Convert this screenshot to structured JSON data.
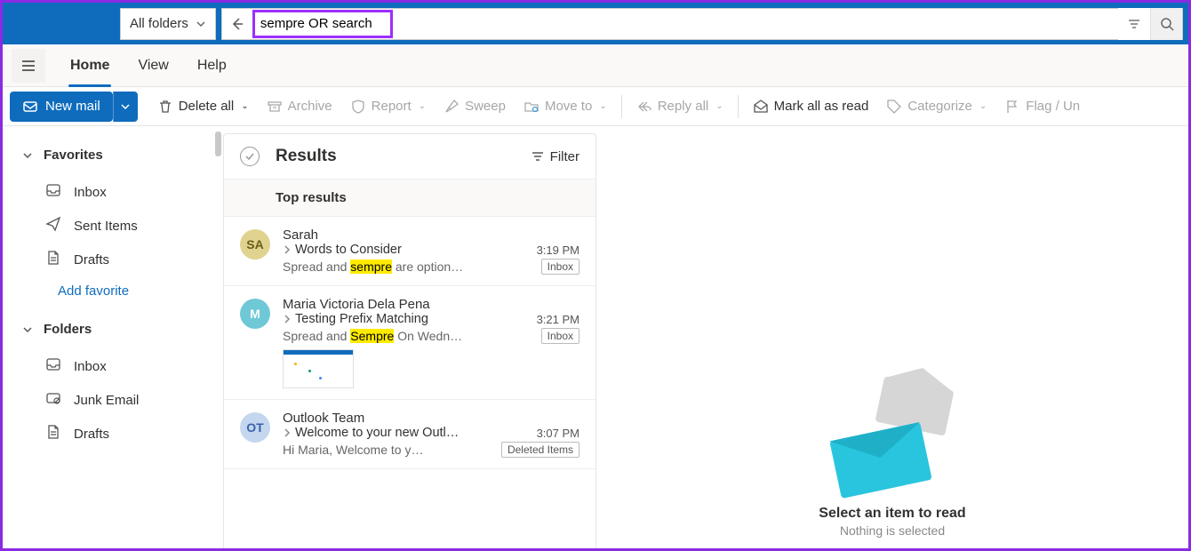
{
  "search": {
    "folder_scope": "All folders",
    "query": "sempre OR search"
  },
  "tabs": [
    "Home",
    "View",
    "Help"
  ],
  "active_tab": 0,
  "toolbar": {
    "new_mail": "New mail",
    "delete_all": "Delete all",
    "archive": "Archive",
    "report": "Report",
    "sweep": "Sweep",
    "move_to": "Move to",
    "reply_all": "Reply all",
    "mark_read": "Mark all as read",
    "categorize": "Categorize",
    "flag": "Flag / Un"
  },
  "sidebar": {
    "sections": [
      {
        "label": "Favorites",
        "items": [
          {
            "icon": "inbox",
            "label": "Inbox"
          },
          {
            "icon": "sent",
            "label": "Sent Items"
          },
          {
            "icon": "draft",
            "label": "Drafts"
          },
          {
            "icon": "link",
            "label": "Add favorite"
          }
        ]
      },
      {
        "label": "Folders",
        "items": [
          {
            "icon": "inbox",
            "label": "Inbox"
          },
          {
            "icon": "junk",
            "label": "Junk Email"
          },
          {
            "icon": "draft",
            "label": "Drafts"
          }
        ]
      }
    ]
  },
  "results": {
    "title": "Results",
    "filter": "Filter",
    "sub": "Top results",
    "items": [
      {
        "initials": "SA",
        "avatar_bg": "#e0d38f",
        "avatar_fg": "#6b5d1a",
        "from": "Sarah",
        "subject": "Words to Consider",
        "time": "3:19 PM",
        "preview_pre": "Spread and ",
        "preview_hl": "sempre",
        "preview_post": " are option…",
        "tag": "Inbox",
        "thumb": false
      },
      {
        "initials": "M",
        "avatar_bg": "#6fc8d6",
        "avatar_fg": "#fff",
        "from": "Maria Victoria Dela Pena",
        "subject": "Testing Prefix Matching",
        "time": "3:21 PM",
        "preview_pre": "Spread and ",
        "preview_hl": "Sempre",
        "preview_post": " On Wedn…",
        "tag": "Inbox",
        "thumb": true
      },
      {
        "initials": "OT",
        "avatar_bg": "#c4d7ef",
        "avatar_fg": "#3a62a8",
        "from": "Outlook Team",
        "subject": "Welcome to your new Outl…",
        "time": "3:07 PM",
        "preview_pre": "Hi Maria, Welcome to y…",
        "preview_hl": "",
        "preview_post": "",
        "tag": "Deleted Items",
        "thumb": false
      }
    ]
  },
  "reading": {
    "title": "Select an item to read",
    "sub": "Nothing is selected"
  }
}
